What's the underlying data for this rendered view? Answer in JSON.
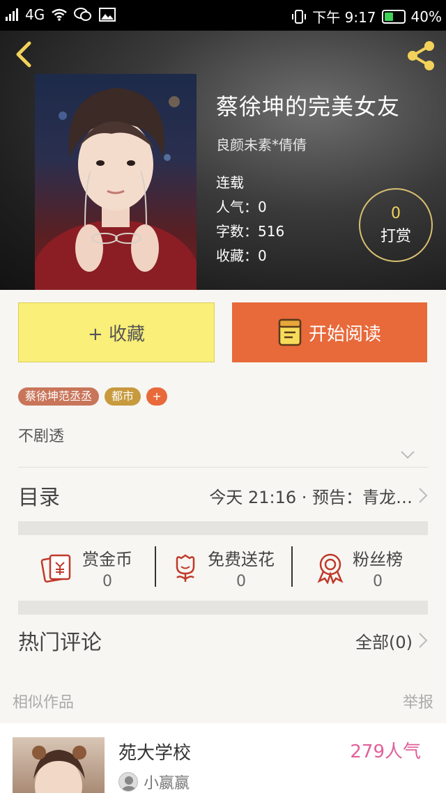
{
  "status_bar": {
    "network": "4G",
    "time": "下午 9:17",
    "battery": "40%"
  },
  "book": {
    "title": "蔡徐坤的完美女友",
    "author": "良颜未素*倩倩",
    "status": "连载",
    "popularity": "人气：0",
    "word_count": "字数：516",
    "favorites": "收藏：0",
    "tip_count": "0",
    "tip_label": "打赏"
  },
  "actions": {
    "favorite_label": "+ 收藏",
    "read_label": "开始阅读"
  },
  "tags": [
    "蔡徐坤范丞丞",
    "都市",
    "+"
  ],
  "description": "不剧透",
  "toc": {
    "title": "目录",
    "update": "今天 21:16 · 预告：青龙…"
  },
  "stats": [
    {
      "label": "赏金币",
      "value": "0",
      "icon": "bounty-coin-icon"
    },
    {
      "label": "免费送花",
      "value": "0",
      "icon": "flower-icon"
    },
    {
      "label": "粉丝榜",
      "value": "0",
      "icon": "medal-icon"
    }
  ],
  "comments": {
    "title": "热门评论",
    "all_label": "全部(0)"
  },
  "similar": {
    "title": "相似作品",
    "report_label": "举报",
    "items": [
      {
        "title": "苑大学校",
        "popularity": "279人气",
        "author": "小嬴嬴"
      }
    ]
  },
  "colors": {
    "favorite_bg": "#faef79",
    "read_bg": "#e8693a",
    "popularity_pink": "#e0609a",
    "tip_ring": "#d8c070"
  }
}
